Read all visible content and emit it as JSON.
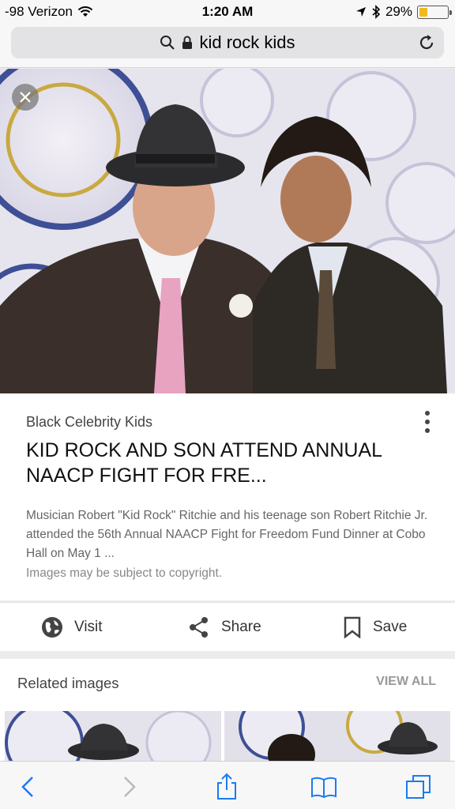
{
  "status_bar": {
    "carrier": "-98 Verizon",
    "time": "1:20 AM",
    "battery": "29%",
    "battery_level": 0.29
  },
  "address_bar": {
    "query": "kid rock kids"
  },
  "result": {
    "source": "Black Celebrity Kids",
    "title": "KID ROCK AND SON ATTEND ANNUAL NAACP FIGHT FOR FRE...",
    "description": "Musician Robert \"Kid Rock\" Ritchie and his teenage son Robert Ritchie Jr. attended the 56th Annual NAACP Fight for Freedom Fund Dinner at Cobo Hall on May 1 ...",
    "copyright": "Images may be subject to copyright."
  },
  "actions": {
    "visit_label": "Visit",
    "share_label": "Share",
    "save_label": "Save"
  },
  "related": {
    "title": "Related images",
    "view_all": "VIEW ALL"
  },
  "icons": {
    "search": "search-icon",
    "lock": "lock-icon",
    "reload": "reload-icon",
    "close": "close-icon",
    "more": "more-vertical-icon",
    "globe": "globe-icon",
    "share": "share-icon",
    "bookmark": "bookmark-icon",
    "back": "back-icon",
    "forward": "forward-icon",
    "share_box": "share-box-icon",
    "book": "book-icon",
    "tabs": "tabs-icon"
  },
  "colors": {
    "ios_blue": "#1a7bf2",
    "battery_yellow": "#f2b91a",
    "pink_tie": "#e8a3c0"
  }
}
